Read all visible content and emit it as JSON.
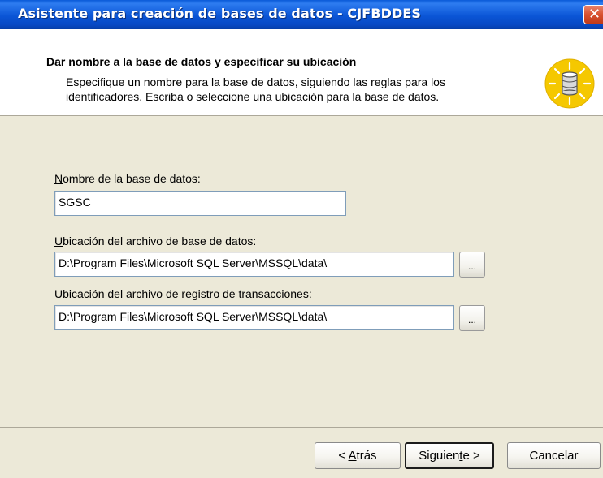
{
  "window": {
    "title": "Asistente para creación de bases de datos - CJFBDDES",
    "close_glyph": "✕"
  },
  "header": {
    "heading": "Dar nombre a la base de datos y especificar su ubicación",
    "description": "Especifique un nombre para la base de datos, siguiendo las reglas para los identificadores. Escriba o seleccione una ubicación para la base de datos.",
    "icon": "database-wizard-icon"
  },
  "form": {
    "db_name": {
      "label_mnemonic": "N",
      "label_rest": "ombre de la base de datos:",
      "value": "SGSC"
    },
    "db_file": {
      "label_mnemonic": "U",
      "label_rest": "bicación del archivo de base de datos:",
      "value": "D:\\Program Files\\Microsoft SQL Server\\MSSQL\\data\\",
      "browse_label": "..."
    },
    "log_file": {
      "label_mnemonic": "U",
      "label_rest": "bicación del archivo de registro de transacciones:",
      "value": "D:\\Program Files\\Microsoft SQL Server\\MSSQL\\data\\",
      "browse_label": "..."
    }
  },
  "buttons": {
    "back_prefix": "< ",
    "back_mnemonic": "A",
    "back_rest": "trás",
    "next_prefix": "Siguien",
    "next_mnemonic": "t",
    "next_rest": "e >",
    "cancel": "Cancelar"
  },
  "colors": {
    "titlebar": "#0a55d6",
    "dialog_bg": "#ece9d8",
    "icon_yellow": "#f5c800"
  }
}
